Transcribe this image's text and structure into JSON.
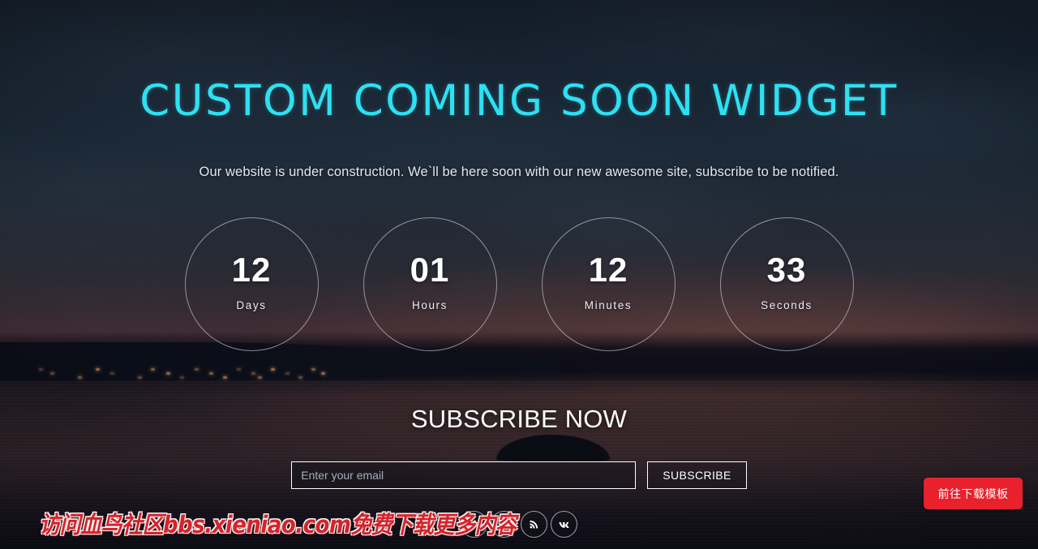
{
  "hero": {
    "title": "CUSTOM COMING SOON WIDGET",
    "subtitle": "Our website is under construction. We`ll be here soon with our new awesome site, subscribe to be notified.",
    "title_color": "#2ee0f2"
  },
  "countdown": {
    "units": [
      {
        "value": "12",
        "label": "Days"
      },
      {
        "value": "01",
        "label": "Hours"
      },
      {
        "value": "12",
        "label": "Minutes"
      },
      {
        "value": "33",
        "label": "Seconds"
      }
    ]
  },
  "subscribe": {
    "title": "SUBSCRIBE NOW",
    "email_placeholder": "Enter your email",
    "email_value": "",
    "button_label": "SUBSCRIBE"
  },
  "socials": [
    {
      "name": "facebook",
      "icon": "facebook-icon"
    },
    {
      "name": "twitter",
      "icon": "twitter-icon"
    },
    {
      "name": "rss",
      "icon": "rss-icon"
    },
    {
      "name": "vk",
      "icon": "vk-icon"
    }
  ],
  "overlay": {
    "watermark_text": "访问血鸟社区bbs.xieniao.com免费下载更多内容",
    "watermark_color": "#d6232c",
    "download_button_label": "前往下载模板",
    "download_button_color": "#e8212d"
  }
}
